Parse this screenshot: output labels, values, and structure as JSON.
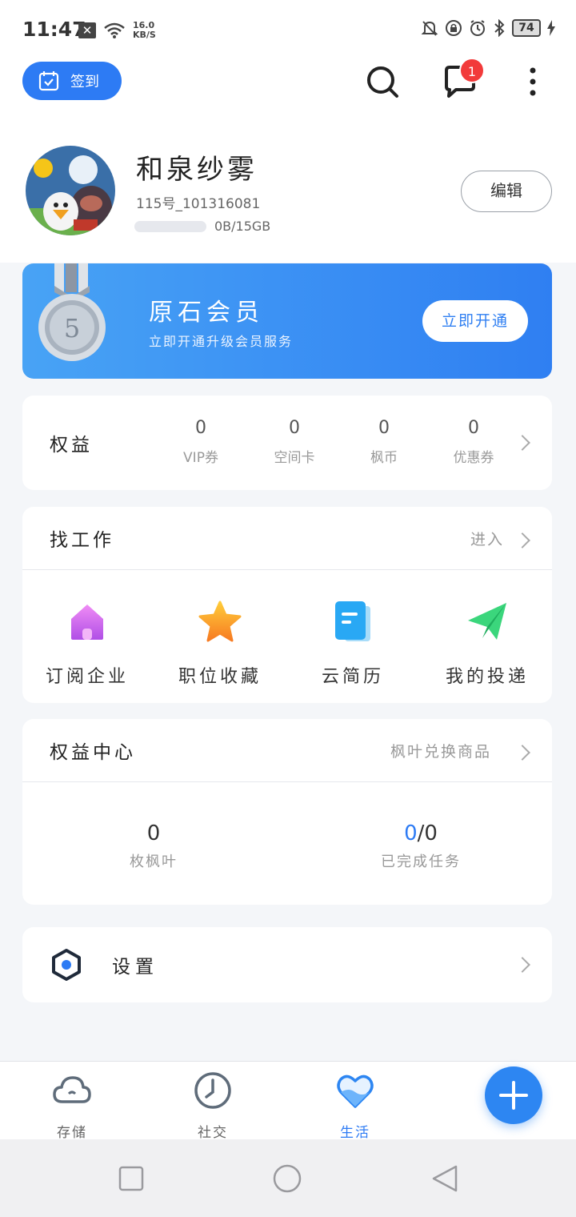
{
  "status_bar": {
    "time": "11:47",
    "speed_value": "16.0",
    "speed_unit": "KB/S",
    "battery": "74"
  },
  "header": {
    "checkin_label": "签到",
    "notification_count": "1"
  },
  "profile": {
    "name": "和泉纱雾",
    "id_text": "115号_101316081",
    "storage_text": "0B/15GB",
    "edit_label": "编辑"
  },
  "vip_card": {
    "medal_number": "5",
    "title": "原石会员",
    "subtitle": "立即开通升级会员服务",
    "button_label": "立即开通"
  },
  "benefits": {
    "title": "权益",
    "items": [
      {
        "value": "0",
        "label": "VIP券"
      },
      {
        "value": "0",
        "label": "空间卡"
      },
      {
        "value": "0",
        "label": "枫币"
      },
      {
        "value": "0",
        "label": "优惠券"
      }
    ]
  },
  "jobs": {
    "title": "找工作",
    "enter_label": "进入",
    "items": [
      {
        "label": "订阅企业",
        "icon": "house-icon"
      },
      {
        "label": "职位收藏",
        "icon": "star-icon"
      },
      {
        "label": "云简历",
        "icon": "document-icon"
      },
      {
        "label": "我的投递",
        "icon": "paper-plane-icon"
      }
    ]
  },
  "rights_center": {
    "title": "权益中心",
    "link_label": "枫叶兑换商品",
    "leaves_value": "0",
    "leaves_label": "枚枫叶",
    "tasks_done": "0",
    "tasks_total": "/0",
    "tasks_label": "已完成任务"
  },
  "settings": {
    "label": "设置"
  },
  "bottom_nav": {
    "items": [
      {
        "label": "存储",
        "icon": "cloud-icon"
      },
      {
        "label": "社交",
        "icon": "clock-icon"
      },
      {
        "label": "生活",
        "icon": "heart-icon"
      }
    ],
    "active": "生活"
  },
  "colors": {
    "accent": "#2d7bf4",
    "badge": "#f23a3a"
  }
}
